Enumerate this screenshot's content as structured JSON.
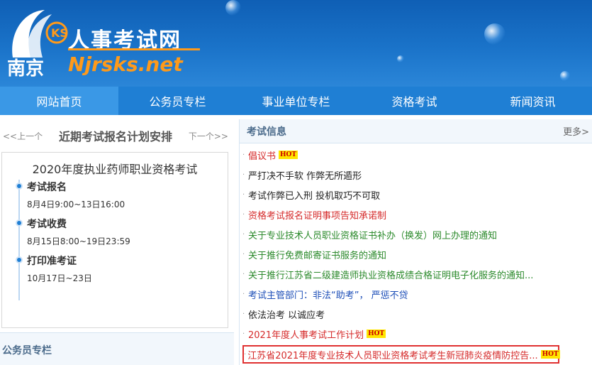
{
  "header": {
    "site_title": "人事考试网",
    "city_name": "南京",
    "site_domain": "Njrsks.net",
    "logo_letters": "KS"
  },
  "nav": {
    "items": [
      {
        "label": "网站首页"
      },
      {
        "label": "公务员专栏"
      },
      {
        "label": "事业单位专栏"
      },
      {
        "label": "资格考试"
      },
      {
        "label": "新闻资讯"
      }
    ]
  },
  "schedule": {
    "prev_label": "<<上一个",
    "title": "近期考试报名计划安排",
    "next_label": "下一个>>",
    "exam_name": "2020年度执业药师职业资格考试",
    "steps": [
      {
        "label": "考试报名",
        "time": "8月4日9:00~13日16:00"
      },
      {
        "label": "考试收费",
        "time": "8月15日8:00~19日23:59"
      },
      {
        "label": "打印准考证",
        "time": "10月17日~23日"
      }
    ]
  },
  "civil_section": {
    "title": "公务员专栏"
  },
  "news": {
    "title": "考试信息",
    "more_label": "更多>",
    "hot_label": "HOT",
    "items": [
      {
        "text": "倡议书",
        "hot": true,
        "color": "#d52a2a"
      },
      {
        "text": "严打决不手软 作弊无所遁形",
        "hot": false,
        "color": "#222222"
      },
      {
        "text": "考试作弊已入刑 投机取巧不可取",
        "hot": false,
        "color": "#222222"
      },
      {
        "text": "资格考试报名证明事项告知承诺制",
        "hot": false,
        "color": "#d52a2a"
      },
      {
        "text": "关于专业技术人员职业资格证书补办（换发）网上办理的通知",
        "hot": false,
        "color": "#2c8a2c"
      },
      {
        "text": "关于推行免费邮寄证书服务的通知",
        "hot": false,
        "color": "#2c8a2c"
      },
      {
        "text": "关于推行江苏省二级建造师执业资格成绩合格证明电子化服务的通知...",
        "hot": false,
        "color": "#2c8a2c"
      },
      {
        "text": "考试主管部门：非法“助考”， 严惩不贷",
        "hot": false,
        "color": "#1e4fb8"
      },
      {
        "text": "依法治考 以诚应考",
        "hot": false,
        "color": "#222222"
      },
      {
        "text": "2021年度人事考试工作计划",
        "hot": true,
        "color": "#d52a2a"
      },
      {
        "text": "江苏省2021年度专业技术人员职业资格考试考生新冠肺炎疫情防控告...",
        "hot": true,
        "color": "#d52a2a"
      }
    ]
  },
  "colors": {
    "header_blue": "#1a73c9",
    "nav_blue": "#1f7fd4",
    "nav_active": "#3a98e6",
    "accent_orange": "#ff9a1a",
    "highlight_border": "#e03030"
  }
}
